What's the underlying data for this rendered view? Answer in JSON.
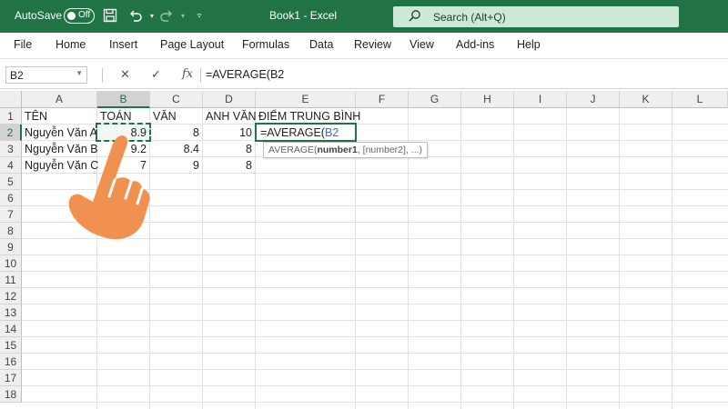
{
  "titlebar": {
    "autosave_label": "AutoSave",
    "autosave_state": "Off",
    "doc_title": "Book1  -  Excel",
    "search_placeholder": "Search (Alt+Q)"
  },
  "ribbon_tabs": [
    "File",
    "Home",
    "Insert",
    "Page Layout",
    "Formulas",
    "Data",
    "Review",
    "View",
    "Add-ins",
    "Help"
  ],
  "formula_bar": {
    "name_box": "B2",
    "fx_label": "fx",
    "formula": "=AVERAGE(B2"
  },
  "grid": {
    "columns": [
      "A",
      "B",
      "C",
      "D",
      "E",
      "F",
      "G",
      "H",
      "I",
      "J",
      "K",
      "L"
    ],
    "rows": [
      "1",
      "2",
      "3",
      "4",
      "5",
      "6",
      "7",
      "8",
      "9",
      "10",
      "11",
      "12",
      "13",
      "14",
      "15",
      "16",
      "17",
      "18"
    ],
    "cells": {
      "A1": "TÊN",
      "B1": "TOÁN",
      "C1": "VĂN",
      "D1": "ANH VĂN",
      "E1": "ĐIỂM TRUNG BÌNH",
      "A2": "Nguyễn Văn A",
      "B2": "8.9",
      "C2": "8",
      "D2": "10",
      "A3": "Nguyễn Văn B",
      "B3": "9.2",
      "C3": "8.4",
      "D3": "8",
      "A4": "Nguyễn Văn C",
      "B4": "7",
      "C4": "9",
      "D4": "8"
    },
    "active_cell": {
      "prefix": "=AVERAGE(",
      "ref": "B2"
    },
    "tooltip": {
      "fn": "AVERAGE(",
      "arg1": "number1",
      "rest": ", [number2], ...)"
    }
  },
  "colors": {
    "excel_green": "#217346",
    "hand_orange": "#f0914f"
  }
}
